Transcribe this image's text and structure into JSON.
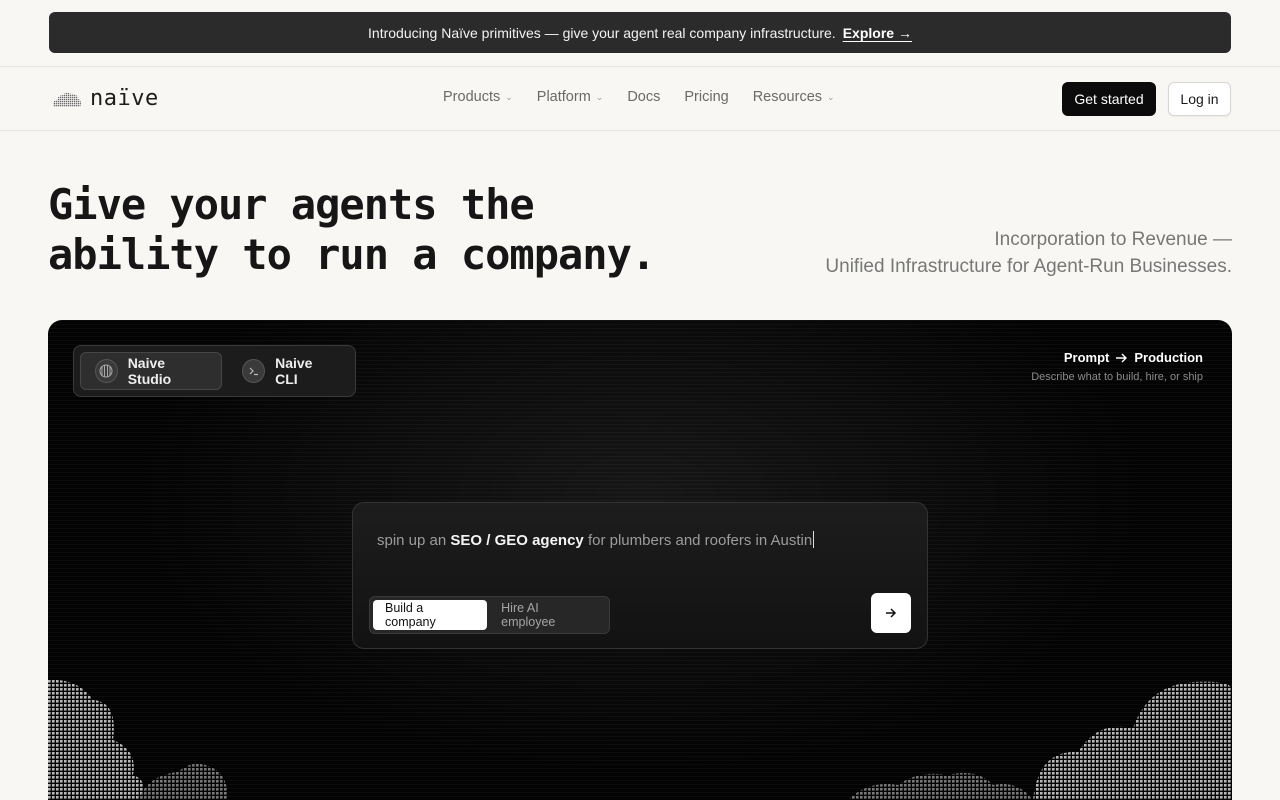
{
  "banner": {
    "text": "Introducing Naïve primitives — give your agent real company infrastructure.",
    "link": "Explore →"
  },
  "nav": {
    "logo": "naïve",
    "links": [
      {
        "label": "Products",
        "dropdown": true
      },
      {
        "label": "Platform",
        "dropdown": true
      },
      {
        "label": "Docs",
        "dropdown": false
      },
      {
        "label": "Pricing",
        "dropdown": false
      },
      {
        "label": "Resources",
        "dropdown": true
      }
    ],
    "get_started": "Get started",
    "login": "Log in"
  },
  "hero": {
    "title_line1": "Give your agents the",
    "title_line2": "ability to run a company.",
    "sub_line1": "Incorporation to Revenue —",
    "sub_line2": "Unified Infrastructure for Agent-Run Businesses."
  },
  "panel": {
    "tabs": [
      {
        "label": "Naive Studio",
        "icon": "grid-globe-icon",
        "active": true
      },
      {
        "label": "Naive CLI",
        "icon": "terminal-icon",
        "active": false
      }
    ],
    "prompt_from": "Prompt",
    "prompt_to": "Production",
    "prompt_desc": "Describe what to build, hire, or ship",
    "input": {
      "prefix": "spin up an ",
      "highlight": "SEO / GEO agency",
      "suffix": " for plumbers and roofers in Austin"
    },
    "modes": [
      {
        "label": "Build a company",
        "active": true
      },
      {
        "label": "Hire AI employee",
        "active": false
      }
    ]
  },
  "colors": {
    "page_bg": "#f8f7f4",
    "banner_bg": "#2b2b2b",
    "panel_bg": "#030303",
    "primary_button": "#0b0b0b"
  }
}
